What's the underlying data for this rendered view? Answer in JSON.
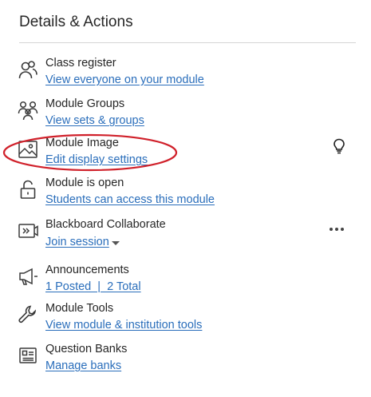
{
  "panel": {
    "heading": "Details & Actions",
    "items": [
      {
        "icon": "class-register-icon",
        "title": "Class register",
        "link": "View everyone on your module"
      },
      {
        "icon": "module-groups-icon",
        "title": "Module Groups",
        "link": "View sets & groups"
      },
      {
        "icon": "module-image-icon",
        "title": "Module Image",
        "link": "Edit display settings"
      },
      {
        "icon": "unlock-icon",
        "title": "Module is open",
        "link": "Students can access this module"
      },
      {
        "icon": "collaborate-icon",
        "title": "Blackboard Collaborate",
        "link": "Join session"
      },
      {
        "icon": "megaphone-icon",
        "title": "Announcements",
        "link": "1 Posted  |  2 Total"
      },
      {
        "icon": "wrench-icon",
        "title": "Module Tools",
        "link": "View module & institution tools"
      },
      {
        "icon": "question-banks-icon",
        "title": "Question Banks",
        "link": "Manage banks"
      }
    ]
  },
  "annotation": {
    "highlight_color": "#d0202a",
    "highlighted_item": "Module Image"
  },
  "colors": {
    "link": "#2a6ebb",
    "text": "#262626",
    "divider": "#d4d4d4",
    "icon": "#3a3a3a"
  }
}
